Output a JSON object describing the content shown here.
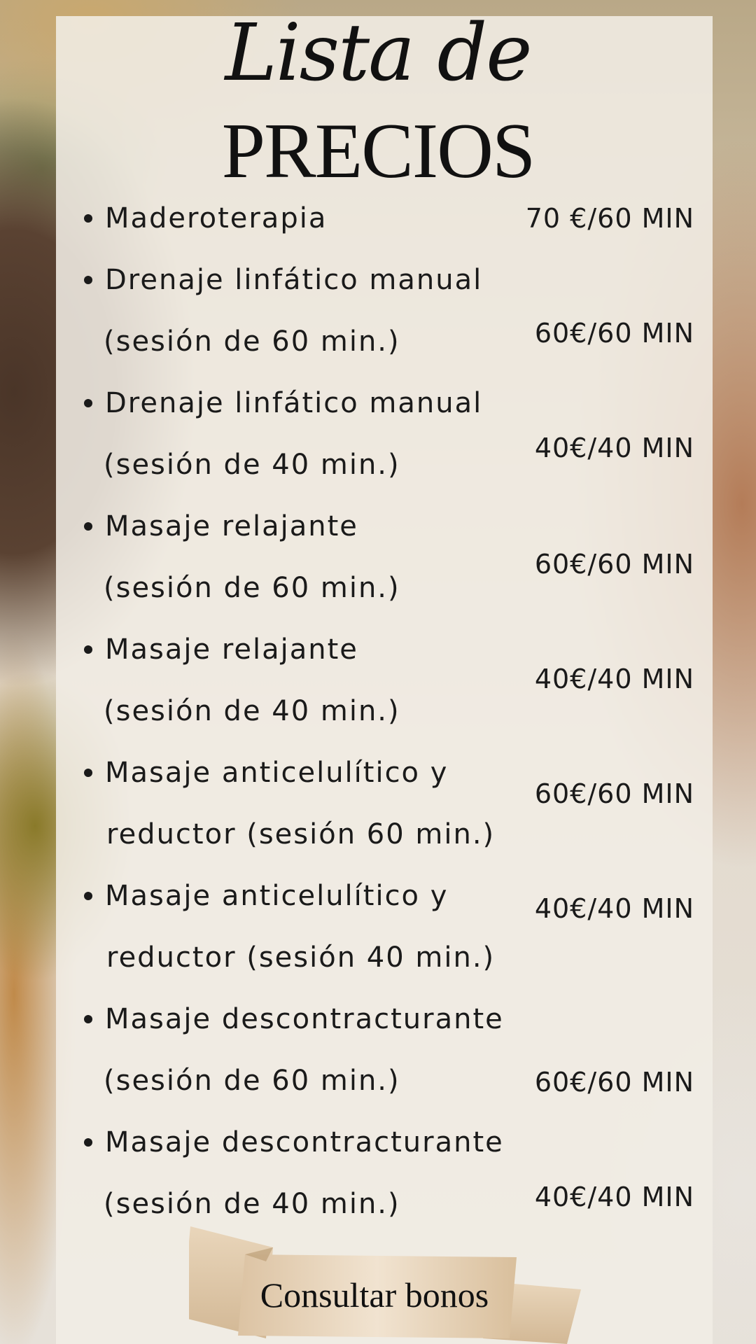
{
  "title": {
    "script": "Lista de",
    "main": "PRECIOS"
  },
  "items": [
    {
      "lines": [
        "Maderoterapia"
      ],
      "price": "70 €/60 MIN"
    },
    {
      "lines": [
        "Drenaje linfático manual",
        "(sesión de 60 min.)"
      ],
      "price": "60€/60 MIN"
    },
    {
      "lines": [
        "Drenaje linfático manual",
        "(sesión de 40 min.)"
      ],
      "price": "40€/40 MIN"
    },
    {
      "lines": [
        "Masaje relajante",
        "(sesión de  60 min.)"
      ],
      "price": "60€/60 MIN"
    },
    {
      "lines": [
        "Masaje relajante",
        "(sesión de 40 min.)"
      ],
      "price": "40€/40 MIN"
    },
    {
      "lines": [
        "Masaje anticelulítico y",
        "reductor (sesión 60 min.)"
      ],
      "price": "60€/60 MIN"
    },
    {
      "lines": [
        "Masaje anticelulítico y",
        "reductor (sesión 40 min.)"
      ],
      "price": "40€/40 MIN"
    },
    {
      "lines": [
        "Masaje descontracturante",
        "(sesión de 60 min.)"
      ],
      "price": "60€/60 MIN"
    },
    {
      "lines": [
        "Masaje descontracturante",
        "(sesión de 40 min.)"
      ],
      "price": "40€/40 MIN"
    }
  ],
  "cta": {
    "label": "Consultar bonos"
  },
  "colors": {
    "panel": "#f1ede5",
    "text": "#1a1a1a",
    "ribbon": "#e9d8c2"
  }
}
